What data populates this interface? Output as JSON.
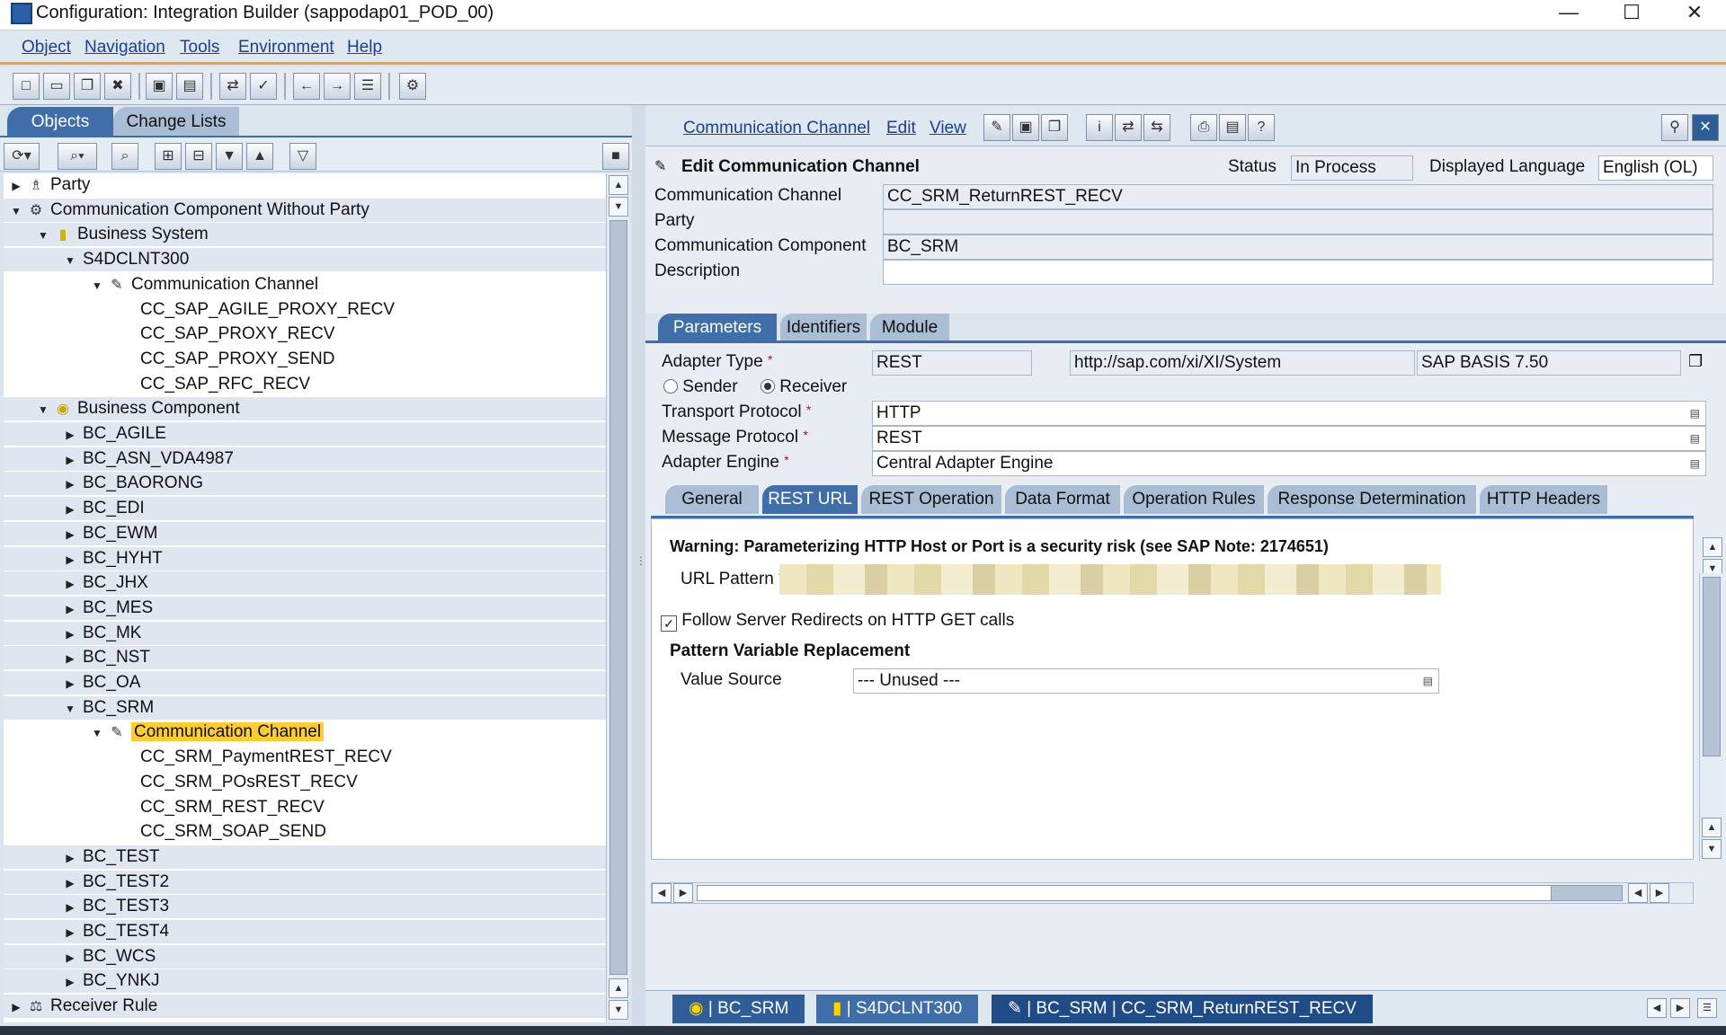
{
  "window": {
    "title": "Configuration: Integration Builder (sappodap01_POD_00)",
    "minimize": "—",
    "maximize": "☐",
    "close": "✕"
  },
  "menubar": [
    "Object",
    "Navigation",
    "Tools",
    "Environment",
    "Help"
  ],
  "left": {
    "tabs": [
      "Objects",
      "Change Lists"
    ],
    "tree": [
      {
        "label": "Party",
        "arrow": "▶",
        "icon": "♗",
        "indent": 0,
        "shade": false
      },
      {
        "label": "Communication Component Without Party",
        "arrow": "▼",
        "icon": "⚙",
        "indent": 0,
        "shade": true
      },
      {
        "label": "Business System",
        "arrow": "▼",
        "icon": "▮",
        "indent": 1,
        "shade": true
      },
      {
        "label": "S4DCLNT300",
        "arrow": "▼",
        "icon": "",
        "indent": 2,
        "shade": true
      },
      {
        "label": "Communication Channel",
        "arrow": "▼",
        "icon": "✎",
        "indent": 3,
        "shade": false
      },
      {
        "label": "CC_SAP_AGILE_PROXY_RECV",
        "arrow": "",
        "icon": "",
        "indent": 4,
        "shade": false
      },
      {
        "label": "CC_SAP_PROXY_RECV",
        "arrow": "",
        "icon": "",
        "indent": 4,
        "shade": false
      },
      {
        "label": "CC_SAP_PROXY_SEND",
        "arrow": "",
        "icon": "",
        "indent": 4,
        "shade": false
      },
      {
        "label": "CC_SAP_RFC_RECV",
        "arrow": "",
        "icon": "",
        "indent": 4,
        "shade": false
      },
      {
        "label": "Business Component",
        "arrow": "▼",
        "icon": "◉",
        "indent": 1,
        "shade": true
      },
      {
        "label": "BC_AGILE",
        "arrow": "▶",
        "icon": "",
        "indent": 2,
        "shade": true
      },
      {
        "label": "BC_ASN_VDA4987",
        "arrow": "▶",
        "icon": "",
        "indent": 2,
        "shade": true
      },
      {
        "label": "BC_BAORONG",
        "arrow": "▶",
        "icon": "",
        "indent": 2,
        "shade": true
      },
      {
        "label": "BC_EDI",
        "arrow": "▶",
        "icon": "",
        "indent": 2,
        "shade": true
      },
      {
        "label": "BC_EWM",
        "arrow": "▶",
        "icon": "",
        "indent": 2,
        "shade": true
      },
      {
        "label": "BC_HYHT",
        "arrow": "▶",
        "icon": "",
        "indent": 2,
        "shade": true
      },
      {
        "label": "BC_JHX",
        "arrow": "▶",
        "icon": "",
        "indent": 2,
        "shade": true
      },
      {
        "label": "BC_MES",
        "arrow": "▶",
        "icon": "",
        "indent": 2,
        "shade": true
      },
      {
        "label": "BC_MK",
        "arrow": "▶",
        "icon": "",
        "indent": 2,
        "shade": true
      },
      {
        "label": "BC_NST",
        "arrow": "▶",
        "icon": "",
        "indent": 2,
        "shade": true
      },
      {
        "label": "BC_OA",
        "arrow": "▶",
        "icon": "",
        "indent": 2,
        "shade": true
      },
      {
        "label": "BC_SRM",
        "arrow": "▼",
        "icon": "",
        "indent": 2,
        "shade": true
      },
      {
        "label": "Communication Channel",
        "arrow": "▼",
        "icon": "✎",
        "indent": 3,
        "shade": false,
        "selected": true
      },
      {
        "label": "CC_SRM_PaymentREST_RECV",
        "arrow": "",
        "icon": "",
        "indent": 4,
        "shade": false
      },
      {
        "label": "CC_SRM_POsREST_RECV",
        "arrow": "",
        "icon": "",
        "indent": 4,
        "shade": false
      },
      {
        "label": "CC_SRM_REST_RECV",
        "arrow": "",
        "icon": "",
        "indent": 4,
        "shade": false
      },
      {
        "label": "CC_SRM_SOAP_SEND",
        "arrow": "",
        "icon": "",
        "indent": 4,
        "shade": false
      },
      {
        "label": "BC_TEST",
        "arrow": "▶",
        "icon": "",
        "indent": 2,
        "shade": true
      },
      {
        "label": "BC_TEST2",
        "arrow": "▶",
        "icon": "",
        "indent": 2,
        "shade": true
      },
      {
        "label": "BC_TEST3",
        "arrow": "▶",
        "icon": "",
        "indent": 2,
        "shade": true
      },
      {
        "label": "BC_TEST4",
        "arrow": "▶",
        "icon": "",
        "indent": 2,
        "shade": true
      },
      {
        "label": "BC_WCS",
        "arrow": "▶",
        "icon": "",
        "indent": 2,
        "shade": true
      },
      {
        "label": "BC_YNKJ",
        "arrow": "▶",
        "icon": "",
        "indent": 2,
        "shade": true
      },
      {
        "label": "Receiver Rule",
        "arrow": "▶",
        "icon": "⚖",
        "indent": 0,
        "shade": true
      }
    ]
  },
  "right": {
    "menu": [
      "Communication Channel",
      "Edit",
      "View"
    ],
    "header": {
      "title": "Edit Communication Channel",
      "status_label": "Status",
      "status_value": "In Process",
      "lang_label": "Displayed Language",
      "lang_value": "English (OL)",
      "channel_label": "Communication Channel",
      "channel_value": "CC_SRM_ReturnREST_RECV",
      "party_label": "Party",
      "party_value": "",
      "component_label": "Communication Component",
      "component_value": "BC_SRM",
      "description_label": "Description",
      "description_value": ""
    },
    "param_tabs": [
      "Parameters",
      "Identifiers",
      "Module"
    ],
    "params": {
      "adapter_type_label": "Adapter Type",
      "adapter_type": "REST",
      "adapter_ns": "http://sap.com/xi/XI/System",
      "adapter_swc": "SAP BASIS 7.50",
      "sender_label": "Sender",
      "receiver_label": "Receiver",
      "transport_label": "Transport Protocol",
      "transport_value": "HTTP",
      "message_label": "Message Protocol",
      "message_value": "REST",
      "engine_label": "Adapter Engine",
      "engine_value": "Central Adapter Engine"
    },
    "sub_tabs": [
      "General",
      "REST URL",
      "REST Operation",
      "Data Format",
      "Operation Rules",
      "Response Determination",
      "HTTP Headers"
    ],
    "rest_url": {
      "warning": "Warning: Parameterizing HTTP Host or Port is a security risk (see SAP Note: 2174651)",
      "url_pattern_label": "URL Pattern",
      "follow_redirects": "Follow Server Redirects on HTTP GET calls",
      "pattern_title": "Pattern Variable Replacement",
      "value_source_label": "Value Source",
      "value_source": "--- Unused ---"
    },
    "statusbar": [
      "| BC_SRM",
      "| S4DCLNT300",
      "| BC_SRM | CC_SRM_ReturnREST_RECV"
    ]
  }
}
